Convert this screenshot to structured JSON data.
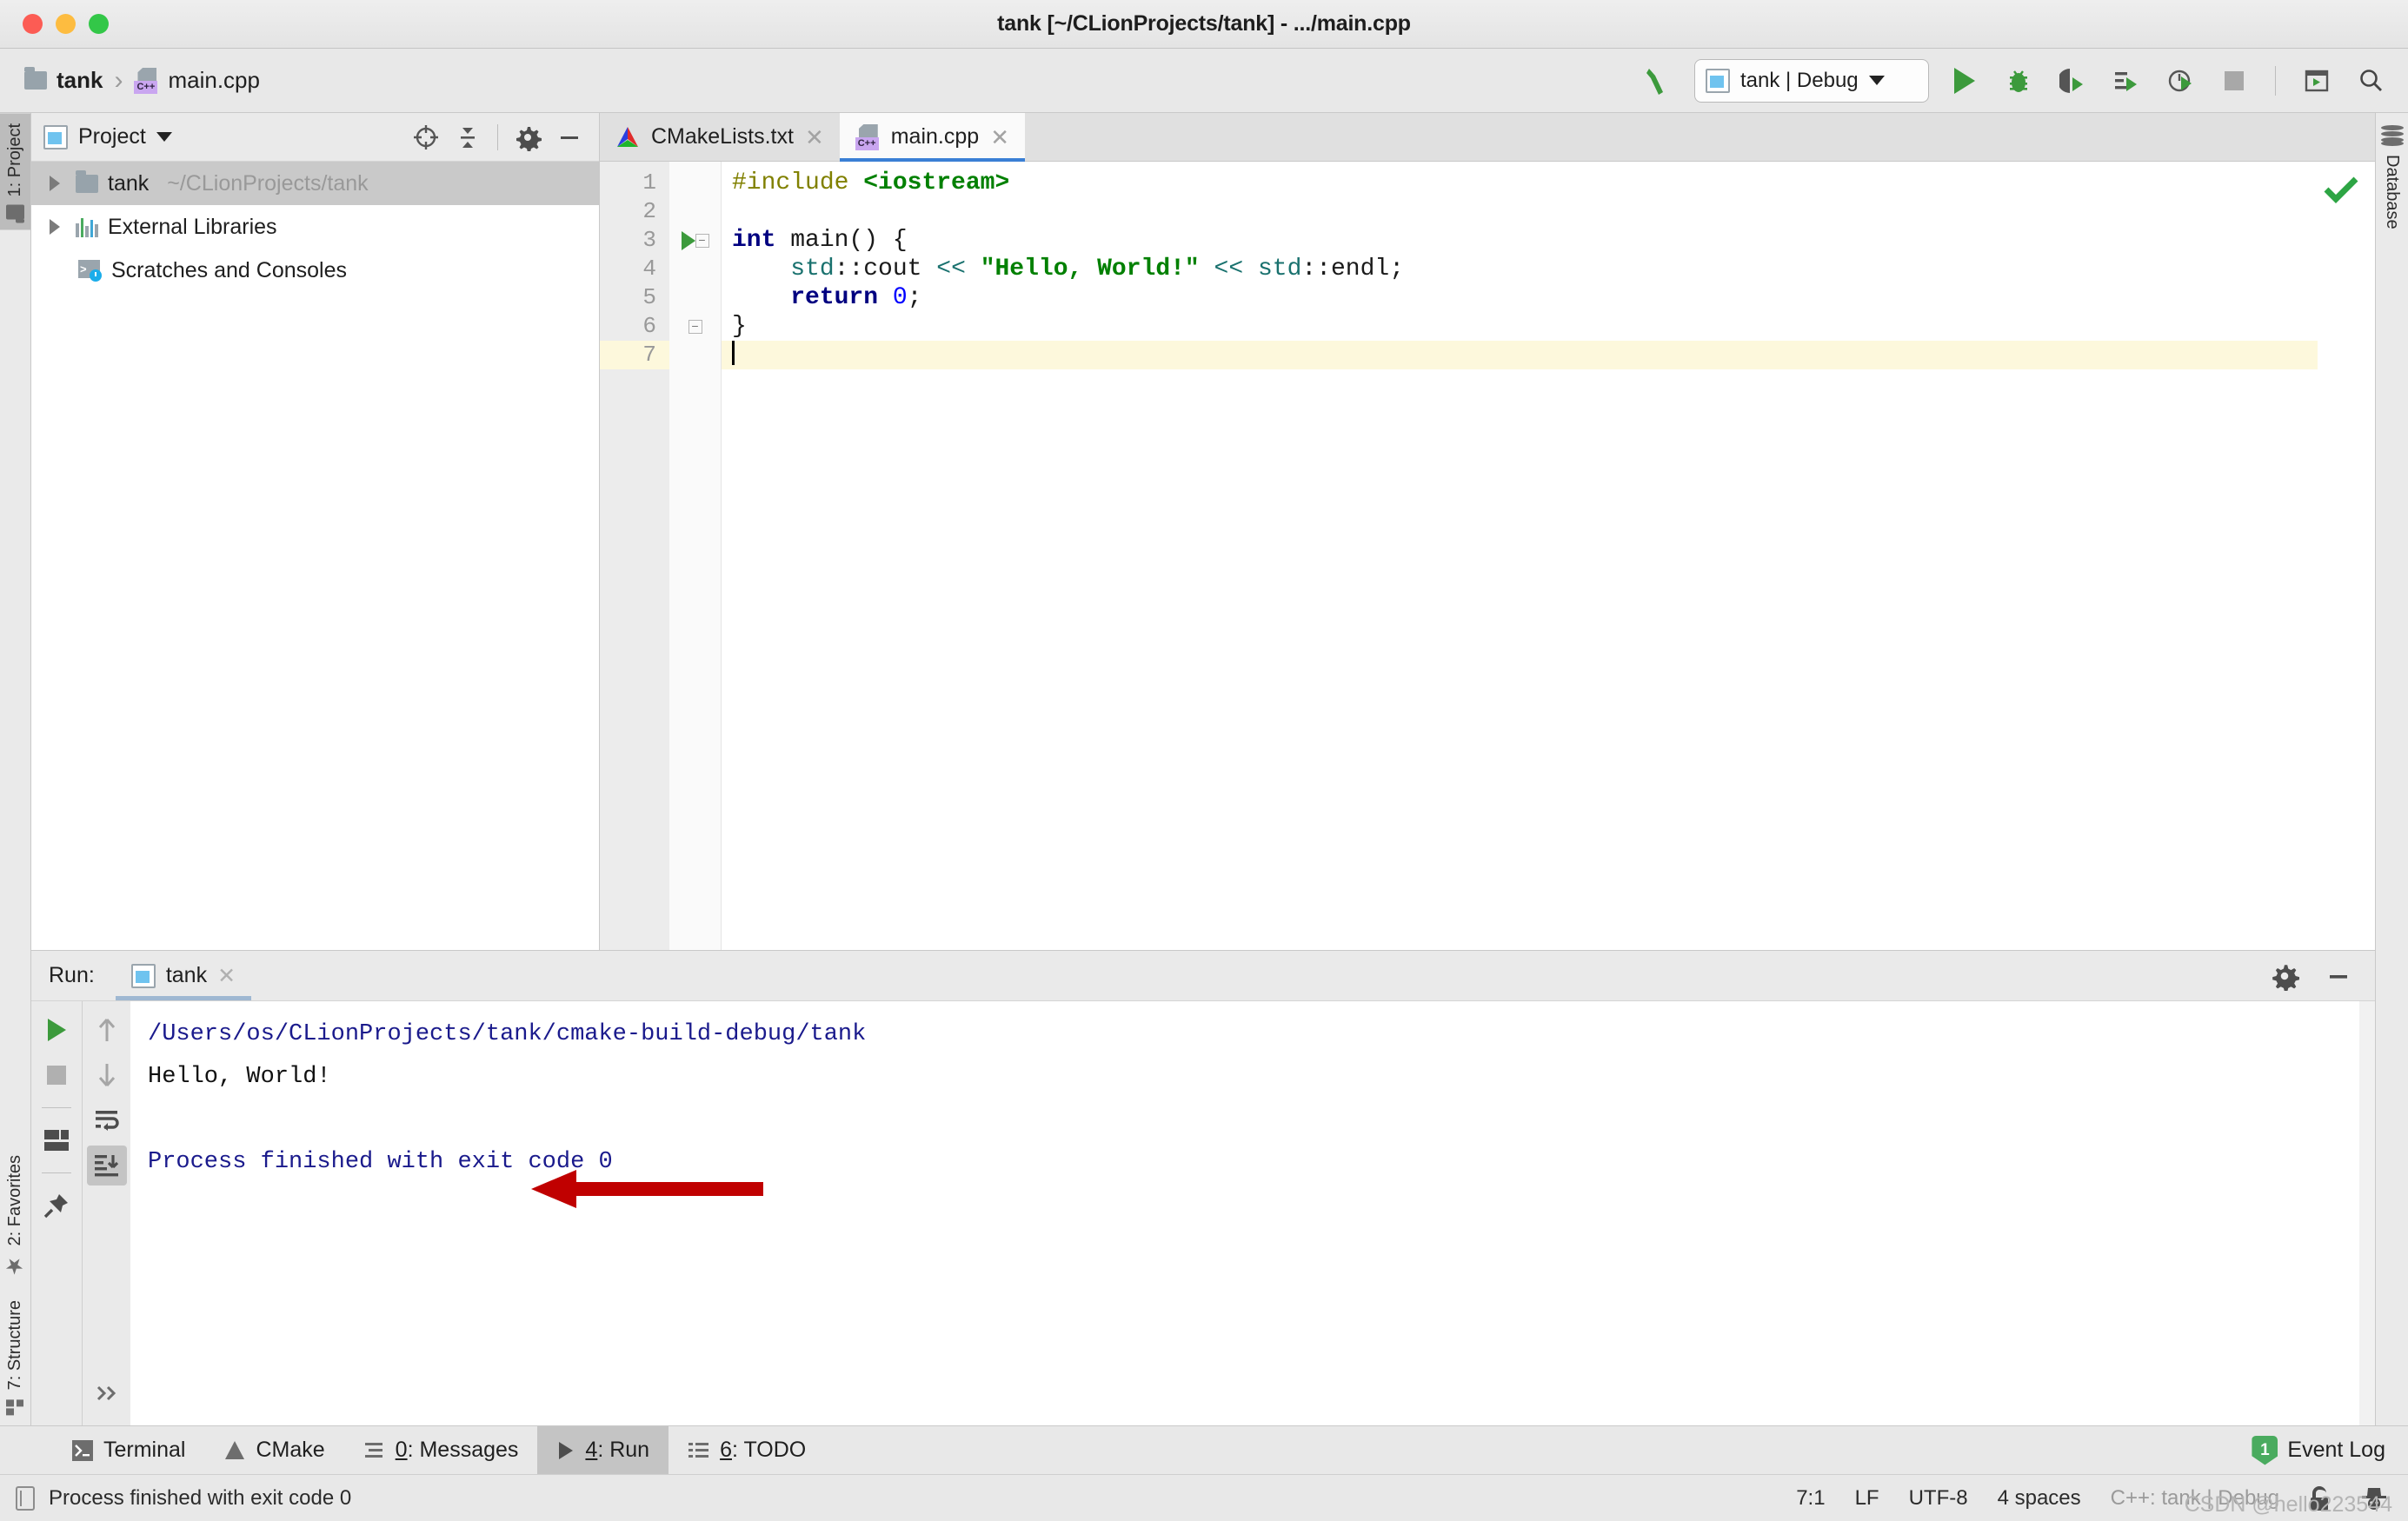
{
  "window": {
    "title": "tank [~/CLionProjects/tank] - .../main.cpp",
    "traffic": {
      "close": "close-window",
      "minimize": "minimize-window",
      "maximize": "maximize-window"
    }
  },
  "navbar": {
    "breadcrumb": [
      {
        "label": "tank",
        "icon": "folder-icon"
      },
      {
        "label": "main.cpp",
        "icon": "cpp-file-icon",
        "badge": "C++"
      }
    ],
    "separator": "›",
    "run_config": {
      "label": "tank | Debug",
      "icon": "run-config-icon",
      "caret": "▼"
    },
    "buttons": [
      {
        "name": "build-button",
        "icon": "hammer-icon"
      },
      {
        "name": "run-button",
        "icon": "play-icon"
      },
      {
        "name": "debug-button",
        "icon": "bug-icon"
      },
      {
        "name": "run-with-coverage-button",
        "icon": "coverage-icon"
      },
      {
        "name": "profile-button",
        "icon": "profiler-icon"
      },
      {
        "name": "attach-to-process-button",
        "icon": "attach-icon"
      },
      {
        "name": "stop-button",
        "icon": "stop-icon"
      },
      {
        "name": "updates-button",
        "icon": "terminal-window-icon"
      },
      {
        "name": "search-everywhere-button",
        "icon": "search-icon"
      }
    ]
  },
  "left_rail": {
    "top": [
      {
        "label": "1: Project",
        "icon": "folder-icon",
        "active": true
      }
    ],
    "bottom": [
      {
        "label": "2: Favorites",
        "icon": "star-icon",
        "active": false
      },
      {
        "label": "7: Structure",
        "icon": "structure-icon",
        "active": false
      }
    ]
  },
  "right_rail": {
    "items": [
      {
        "label": "Database",
        "icon": "database-icon"
      }
    ]
  },
  "project": {
    "header": {
      "title": "Project",
      "caret": "▼",
      "icon": "project-view-icon",
      "buttons": [
        {
          "name": "select-opened-file-button",
          "icon": "crosshair-icon"
        },
        {
          "name": "collapse-all-button",
          "icon": "collapse-all-icon"
        },
        {
          "name": "settings-button",
          "icon": "gear-icon"
        },
        {
          "name": "hide-button",
          "icon": "minimize-icon"
        }
      ]
    },
    "tree": [
      {
        "label": "tank",
        "path": "~/CLionProjects/tank",
        "icon": "folder-icon",
        "arrow": true,
        "selected": true,
        "indent": 0
      },
      {
        "label": "External Libraries",
        "path": "",
        "icon": "libraries-icon",
        "arrow": true,
        "selected": false,
        "indent": 0
      },
      {
        "label": "Scratches and Consoles",
        "path": "",
        "icon": "scratches-icon",
        "arrow": false,
        "selected": false,
        "indent": 1
      }
    ]
  },
  "editor": {
    "tabs": [
      {
        "label": "CMakeLists.txt",
        "icon": "cmake-icon",
        "close": "✕",
        "active": false
      },
      {
        "label": "main.cpp",
        "icon": "cpp-file-icon",
        "badge": "C++",
        "close": "✕",
        "active": true
      }
    ],
    "line_numbers": [
      "1",
      "2",
      "3",
      "4",
      "5",
      "6",
      "7"
    ],
    "current_line": 7,
    "inspection_status": "check-ok",
    "code_lines": [
      {
        "n": 1,
        "tokens": [
          {
            "t": "#include ",
            "c": "k-pre"
          },
          {
            "t": "<iostream>",
            "c": "k-hdr"
          }
        ]
      },
      {
        "n": 2,
        "tokens": []
      },
      {
        "n": 3,
        "gutter_icon": "run-gutter-icon",
        "fold": "minus",
        "tokens": [
          {
            "t": "int",
            "c": "k-kw"
          },
          {
            "t": " main() {",
            "c": "k-plain"
          }
        ]
      },
      {
        "n": 4,
        "tokens": [
          {
            "t": "    ",
            "c": "k-plain"
          },
          {
            "t": "std",
            "c": "k-ns"
          },
          {
            "t": "::cout ",
            "c": "k-plain"
          },
          {
            "t": "<<",
            "c": "k-op"
          },
          {
            "t": " ",
            "c": "k-plain"
          },
          {
            "t": "\"Hello, World!\"",
            "c": "k-str"
          },
          {
            "t": " ",
            "c": "k-plain"
          },
          {
            "t": "<<",
            "c": "k-op"
          },
          {
            "t": " ",
            "c": "k-plain"
          },
          {
            "t": "std",
            "c": "k-ns"
          },
          {
            "t": "::endl;",
            "c": "k-plain"
          }
        ]
      },
      {
        "n": 5,
        "tokens": [
          {
            "t": "    ",
            "c": "k-plain"
          },
          {
            "t": "return",
            "c": "k-kw"
          },
          {
            "t": " ",
            "c": "k-plain"
          },
          {
            "t": "0",
            "c": "k-num"
          },
          {
            "t": ";",
            "c": "k-plain"
          }
        ]
      },
      {
        "n": 6,
        "fold": "end",
        "tokens": [
          {
            "t": "}",
            "c": "k-plain"
          }
        ]
      },
      {
        "n": 7,
        "tokens": [],
        "caret": true
      }
    ]
  },
  "run_panel": {
    "label": "Run:",
    "tab": {
      "label": "tank",
      "icon": "run-config-icon",
      "close": "✕"
    },
    "header_buttons": [
      {
        "name": "run-settings-button",
        "icon": "gear-icon"
      },
      {
        "name": "hide-run-panel-button",
        "icon": "minimize-icon"
      }
    ],
    "tools_left": [
      {
        "name": "rerun-button",
        "icon": "play-icon"
      },
      {
        "name": "stop-button",
        "icon": "stop-icon"
      },
      {
        "name": "layout-button",
        "icon": "layout-icon"
      },
      {
        "name": "pin-tab-button",
        "icon": "pin-icon"
      }
    ],
    "tools_right": [
      {
        "name": "up-stacktrace-button",
        "icon": "arrow-up-icon"
      },
      {
        "name": "down-stacktrace-button",
        "icon": "arrow-down-icon"
      },
      {
        "name": "soft-wrap-button",
        "icon": "soft-wrap-icon"
      },
      {
        "name": "scroll-to-end-button",
        "icon": "scroll-to-end-icon",
        "selected": true
      },
      {
        "name": "more-button",
        "icon": "chevrons-right-icon"
      }
    ],
    "console": [
      {
        "text": "/Users/os/CLionProjects/tank/cmake-build-debug/tank",
        "color": "c-blue"
      },
      {
        "text": "Hello, World!",
        "color": "c-black"
      },
      {
        "text": "",
        "color": "c-black"
      },
      {
        "text": "Process finished with exit code 0",
        "color": "c-blue"
      }
    ],
    "annotation": {
      "name": "red-arrow-annotation",
      "color": "#c00000"
    }
  },
  "toolwindow_bar": {
    "items": [
      {
        "label": "Terminal",
        "mnemonic": "",
        "icon": "terminal-icon",
        "active": false
      },
      {
        "label": "CMake",
        "mnemonic": "",
        "icon": "cmake-icon",
        "active": false
      },
      {
        "label": ": Messages",
        "mnemonic": "0",
        "icon": "messages-icon",
        "active": false
      },
      {
        "label": ": Run",
        "mnemonic": "4",
        "icon": "play-icon",
        "active": true
      },
      {
        "label": ": TODO",
        "mnemonic": "6",
        "icon": "todo-icon",
        "active": false
      }
    ],
    "event_log": {
      "label": "Event Log",
      "count": "1",
      "badge_color": "#4aab5f"
    }
  },
  "statusbar": {
    "message": "Process finished with exit code 0",
    "caret_position": "7:1",
    "line_separator": "LF",
    "encoding": "UTF-8",
    "indent": "4 spaces",
    "config": "C++: tank | Debug",
    "icons": [
      {
        "name": "lock-icon"
      },
      {
        "name": "inspector-hat-icon"
      }
    ]
  },
  "watermark": {
    "text": "CSDN @hello223544"
  },
  "colors": {
    "accent_blue": "#3a7fd5",
    "green": "#3c9a3c",
    "selection_gray": "#c9c9c9",
    "current_line": "#fdf8dc",
    "red_arrow": "#c00000"
  }
}
